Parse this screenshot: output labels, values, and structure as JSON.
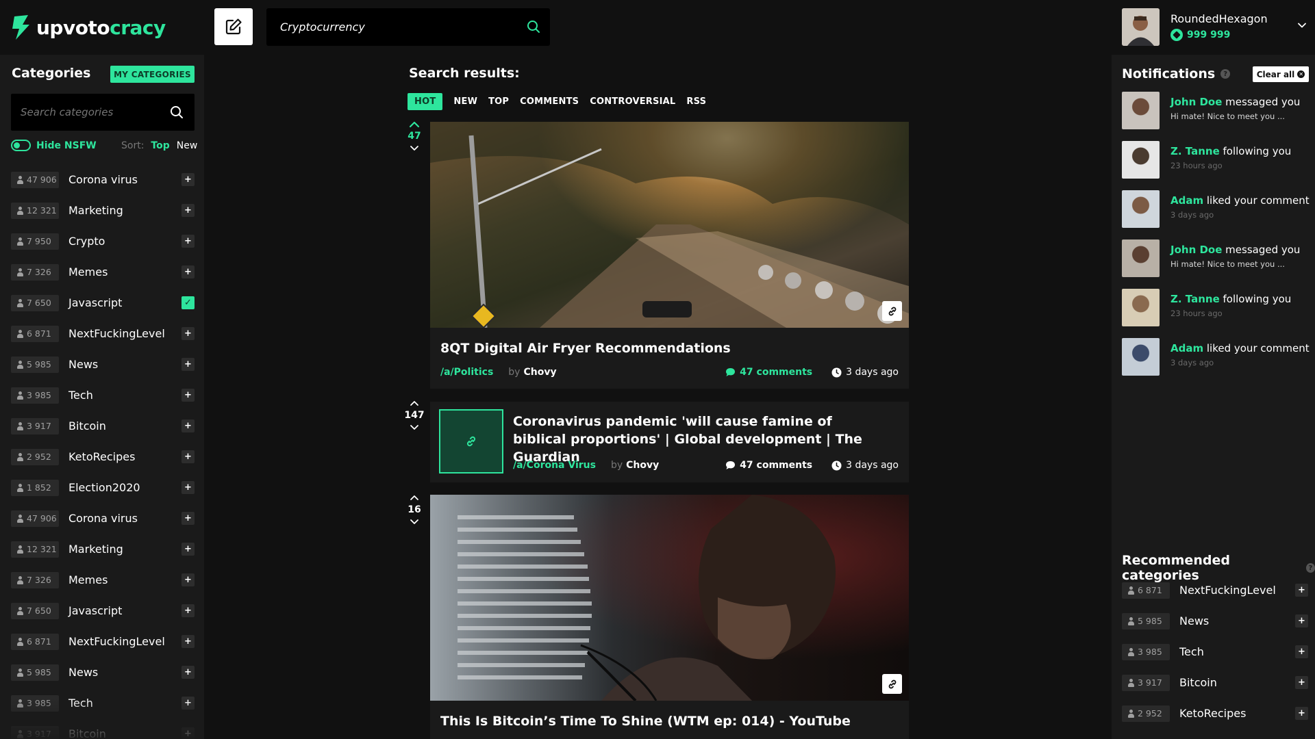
{
  "header": {
    "logo_text_1": "upvoto",
    "logo_text_2": "cracy",
    "search_value": "Cryptocurrency",
    "user_name": "RoundedHexagon",
    "user_coins": "999 999"
  },
  "sidebar": {
    "title": "Categories",
    "my_categories_label": "MY CATEGORIES",
    "search_placeholder": "Search categories",
    "nsfw_label": "Hide NSFW",
    "sort_label": "Sort:",
    "sort_top": "Top",
    "sort_new": "New",
    "categories": [
      {
        "count": "47 906",
        "name": "Corona virus",
        "checked": false
      },
      {
        "count": "12 321",
        "name": "Marketing",
        "checked": false
      },
      {
        "count": "7 950",
        "name": "Crypto",
        "checked": false
      },
      {
        "count": "7 326",
        "name": "Memes",
        "checked": false
      },
      {
        "count": "7 650",
        "name": "Javascript",
        "checked": true
      },
      {
        "count": "6 871",
        "name": "NextFuckingLevel",
        "checked": false
      },
      {
        "count": "5 985",
        "name": "News",
        "checked": false
      },
      {
        "count": "3 985",
        "name": "Tech",
        "checked": false
      },
      {
        "count": "3 917",
        "name": "Bitcoin",
        "checked": false
      },
      {
        "count": "2 952",
        "name": "KetoRecipes",
        "checked": false
      },
      {
        "count": "1 852",
        "name": "Election2020",
        "checked": false
      },
      {
        "count": "47 906",
        "name": "Corona virus",
        "checked": false
      },
      {
        "count": "12 321",
        "name": "Marketing",
        "checked": false
      },
      {
        "count": "7 326",
        "name": "Memes",
        "checked": false
      },
      {
        "count": "7 650",
        "name": "Javascript",
        "checked": false
      },
      {
        "count": "6 871",
        "name": "NextFuckingLevel",
        "checked": false
      },
      {
        "count": "5 985",
        "name": "News",
        "checked": false
      },
      {
        "count": "3 985",
        "name": "Tech",
        "checked": false
      },
      {
        "count": "3 917",
        "name": "Bitcoin",
        "checked": false
      }
    ]
  },
  "main": {
    "title": "Search results:",
    "tabs": [
      "HOT",
      "NEW",
      "TOP",
      "COMMENTS",
      "CONTROVERSIAL",
      "RSS"
    ],
    "posts": [
      {
        "votes": "47",
        "title": "8QT Digital Air Fryer Recommendations",
        "sub": "/a/Politics",
        "by": "by",
        "author": "Chovy",
        "comments": "47 comments",
        "time": "3 days ago"
      },
      {
        "votes": "147",
        "title": "Coronavirus pandemic 'will cause famine of biblical proportions' | Global development | The Guardian",
        "sub": "/a/Corona Virus",
        "by": "by",
        "author": "Chovy",
        "comments": "47 comments",
        "time": "3 days ago"
      },
      {
        "votes": "16",
        "title": "This Is Bitcoin’s Time To Shine (WTM ep: 014) - YouTube"
      }
    ]
  },
  "notifications": {
    "title": "Notifications",
    "clear_label": "Clear all",
    "items": [
      {
        "who": "John Doe",
        "action": " messaged you",
        "detail": "Hi mate! Nice to meet you ..."
      },
      {
        "who": "Z. Tanne",
        "action": " following you",
        "detail": "23 hours ago"
      },
      {
        "who": "Adam",
        "action": " liked your comment",
        "detail": "3 days ago"
      },
      {
        "who": "John Doe",
        "action": " messaged you",
        "detail": "Hi mate! Nice to meet you ..."
      },
      {
        "who": "Z. Tanne",
        "action": " following you",
        "detail": "23 hours ago"
      },
      {
        "who": "Adam",
        "action": " liked your comment",
        "detail": "3 days ago"
      }
    ]
  },
  "recommended": {
    "title": "Recommended categories",
    "items": [
      {
        "count": "6 871",
        "name": "NextFuckingLevel"
      },
      {
        "count": "5 985",
        "name": "News"
      },
      {
        "count": "3 985",
        "name": "Tech"
      },
      {
        "count": "3 917",
        "name": "Bitcoin"
      },
      {
        "count": "2 952",
        "name": "KetoRecipes"
      }
    ]
  },
  "colors": {
    "accent": "#2ee59d",
    "background": "#111111",
    "panel": "#1a1a1a"
  }
}
